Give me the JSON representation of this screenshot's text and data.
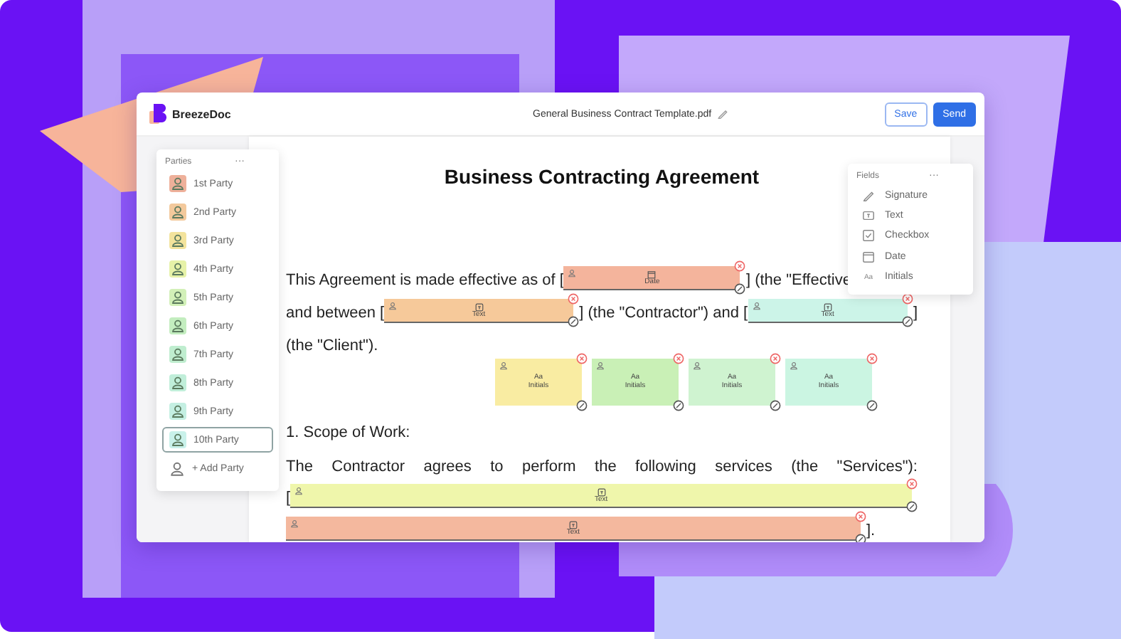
{
  "app": {
    "logo_text": "BreezeDoc",
    "file_name": "General Business Contract Template.pdf",
    "buttons": [
      {
        "label": "Save",
        "kind": "secondary"
      },
      {
        "label": "Send",
        "kind": "primary"
      }
    ]
  },
  "parties": {
    "title": "Parties",
    "menu": "···",
    "items": [
      {
        "label": "1st Party",
        "color": "#eeb09a",
        "selected": false
      },
      {
        "label": "2nd Party",
        "color": "#f3c99c",
        "selected": false
      },
      {
        "label": "3rd Party",
        "color": "#f3e39c",
        "selected": false
      },
      {
        "label": "4th Party",
        "color": "#e6f2a8",
        "selected": false
      },
      {
        "label": "5th Party",
        "color": "#d2f0b8",
        "selected": false
      },
      {
        "label": "6th Party",
        "color": "#c3edbf",
        "selected": false
      },
      {
        "label": "7th Party",
        "color": "#bfedcf",
        "selected": false
      },
      {
        "label": "8th Party",
        "color": "#c0eed9",
        "selected": false
      },
      {
        "label": "9th Party",
        "color": "#c4efe2",
        "selected": false
      },
      {
        "label": "10th Party",
        "color": "#c9f1ea",
        "selected": true
      }
    ],
    "add_label": "+ Add Party"
  },
  "fields_panel": {
    "title": "Fields",
    "menu": "···",
    "items": [
      {
        "kind": "signature",
        "label": "Signature"
      },
      {
        "kind": "text",
        "label": "Text"
      },
      {
        "kind": "checkbox",
        "label": "Checkbox"
      },
      {
        "kind": "date",
        "label": "Date"
      },
      {
        "kind": "initials",
        "label": "Initials",
        "glyph": "Aa"
      }
    ]
  },
  "document": {
    "title": "Business Contracting Agreement",
    "blocks": [
      {
        "kind": "line",
        "segments": [
          {
            "kind": "text",
            "text": "This Agreement is made effective as of ["
          },
          {
            "kind": "field",
            "field": {
              "kind": "date",
              "label": "Date",
              "color": "#f4b49c"
            }
          },
          {
            "kind": "text",
            "text": "] (the \"Effective"
          }
        ]
      },
      {
        "kind": "line",
        "segments": [
          {
            "kind": "text",
            "text": "and between ["
          },
          {
            "kind": "field",
            "field": {
              "kind": "text",
              "label": "Text",
              "color": "#f6c99a"
            }
          },
          {
            "kind": "text",
            "text": "] (the \"Contractor\") and ["
          },
          {
            "kind": "field",
            "field": {
              "kind": "text",
              "label": "Text",
              "color": "#ccf4e8"
            }
          },
          {
            "kind": "text",
            "text": "]"
          }
        ]
      },
      {
        "kind": "line",
        "segments": [
          {
            "kind": "text",
            "text": "(the \"Client\")."
          }
        ]
      },
      {
        "kind": "initials_row",
        "items": [
          {
            "glyph": "Aa",
            "label": "Initials",
            "color": "#f9eca2"
          },
          {
            "glyph": "Aa",
            "label": "Initials",
            "color": "#c9f0b6"
          },
          {
            "glyph": "Aa",
            "label": "Initials",
            "color": "#cff3d0"
          },
          {
            "glyph": "Aa",
            "label": "Initials",
            "color": "#cbf5e2"
          }
        ]
      },
      {
        "kind": "line",
        "segments": [
          {
            "kind": "text",
            "text": "1. Scope of Work:"
          }
        ]
      },
      {
        "kind": "paragraph",
        "text": "The Contractor agrees to perform the following services (the \"Services\"):"
      },
      {
        "kind": "line",
        "segments": [
          {
            "kind": "text",
            "text": "["
          },
          {
            "kind": "field",
            "field": {
              "kind": "text",
              "label": "Text",
              "color": "#eff6ab"
            }
          }
        ]
      },
      {
        "kind": "line",
        "segments": [
          {
            "kind": "field",
            "field": {
              "kind": "text",
              "label": "Text",
              "color": "#f4b89e"
            }
          },
          {
            "kind": "text",
            "text": "]."
          }
        ]
      }
    ]
  }
}
